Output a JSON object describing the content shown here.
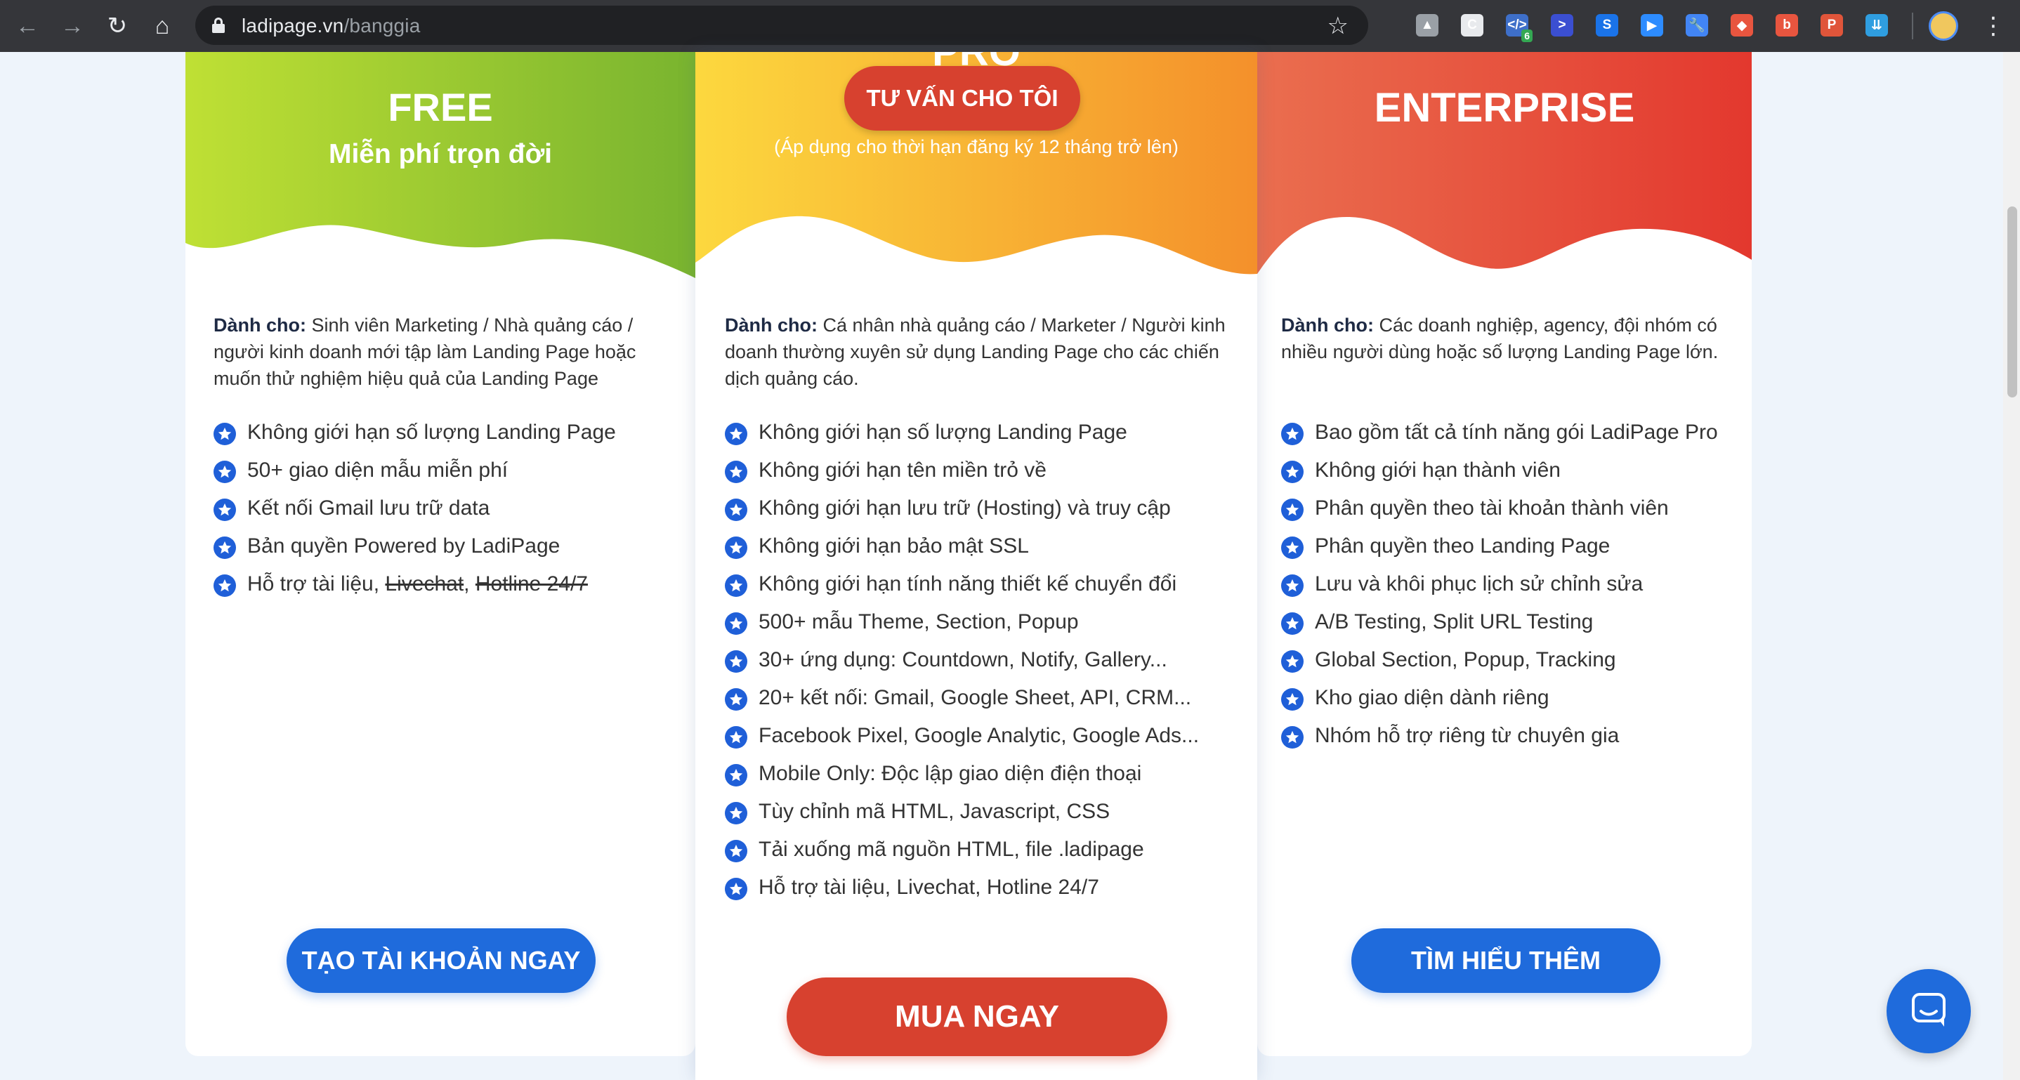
{
  "browser": {
    "url_domain": "ladipage.vn",
    "url_path": "/banggia",
    "extension_icons": [
      {
        "name": "google-drive-icon",
        "color": "#9aa0a6",
        "glyph": "▲"
      },
      {
        "name": "ext-c-icon",
        "color": "#e8eaed",
        "glyph": "C"
      },
      {
        "name": "code-icon",
        "color": "#3e6fc9",
        "glyph": "</>"
      },
      {
        "name": "terminal-icon",
        "color": "#3b4fd1",
        "glyph": ">"
      },
      {
        "name": "s-extension-icon",
        "color": "#1a73e8",
        "glyph": "S"
      },
      {
        "name": "zoom-icon",
        "color": "#2d8cff",
        "glyph": "▶"
      },
      {
        "name": "wrench-icon",
        "color": "#4285f4",
        "glyph": "🔧"
      },
      {
        "name": "shield-icon",
        "color": "#e8553f",
        "glyph": "◆"
      },
      {
        "name": "b-extension-icon",
        "color": "#e8553f",
        "glyph": "b"
      },
      {
        "name": "p-extension-icon",
        "color": "#e0553a",
        "glyph": "P"
      },
      {
        "name": "download-icon",
        "color": "#2f9ee0",
        "glyph": "⇊"
      }
    ],
    "extension_badge": "6"
  },
  "colors": {
    "free_gradient": [
      "#bfe034",
      "#79b42f"
    ],
    "pro_gradient": [
      "#fcd83e",
      "#f4902b"
    ],
    "enterprise_gradient": [
      "#ea6e4f",
      "#e3382e"
    ],
    "accent_blue": "#1f6bdc",
    "accent_red": "#d7412f"
  },
  "plans": {
    "free": {
      "name": "FREE",
      "subtitle": "Miễn phí trọn đời",
      "for_label": "Dành cho:",
      "for_text": "Sinh viên Marketing / Nhà quảng cáo / người kinh doanh mới tập làm Landing Page hoặc muốn thử nghiệm hiệu quả của Landing Page",
      "features": [
        "Không giới hạn số lượng Landing Page",
        "50+ giao diện mẫu miễn phí",
        "Kết nối Gmail lưu trữ data",
        "Bản quyền Powered by LadiPage"
      ],
      "support_prefix": "Hỗ trợ tài liệu,",
      "support_livechat": "Livechat",
      "support_comma": ",",
      "support_hotline": "Hotline 24/7",
      "button": "TẠO TÀI KHOẢN NGAY"
    },
    "pro": {
      "name_cut": "PRO",
      "consult_button": "TƯ VẤN CHO TÔI",
      "note": "(Áp dụng cho thời hạn đăng ký 12 tháng trở lên)",
      "for_label": "Dành cho:",
      "for_text": "Cá nhân nhà quảng cáo / Marketer / Người kinh doanh thường xuyên sử dụng Landing Page cho các chiến dịch quảng cáo.",
      "features": [
        "Không giới hạn số lượng Landing Page",
        "Không giới hạn tên miền trỏ về",
        "Không giới hạn lưu trữ (Hosting) và truy cập",
        "Không giới hạn bảo mật SSL",
        "Không giới hạn tính năng thiết kế chuyển đổi",
        "500+ mẫu Theme, Section, Popup",
        "30+ ứng dụng: Countdown, Notify, Gallery...",
        "20+ kết nối: Gmail, Google Sheet, API, CRM...",
        "Facebook Pixel, Google Analytic, Google Ads...",
        "Mobile Only: Độc lập giao diện điện thoại",
        "Tùy chỉnh mã HTML, Javascript, CSS",
        "Tải xuống mã nguồn HTML, file .ladipage",
        "Hỗ trợ tài liệu, Livechat, Hotline 24/7"
      ],
      "button": "MUA NGAY"
    },
    "enterprise": {
      "name": "ENTERPRISE",
      "for_label": "Dành cho:",
      "for_text": "Các doanh nghiệp, agency, đội nhóm có nhiều người dùng hoặc số lượng Landing Page lớn.",
      "features": [
        "Bao gồm tất cả tính năng gói LadiPage Pro",
        "Không giới hạn thành viên",
        "Phân quyền theo tài khoản thành viên",
        "Phân quyền theo Landing Page",
        "Lưu và khôi phục lịch sử chỉnh sửa",
        "A/B Testing, Split URL Testing",
        "Global Section, Popup, Tracking",
        "Kho giao diện dành riêng",
        "Nhóm hỗ trợ riêng từ chuyên gia"
      ],
      "button": "TÌM HIỂU THÊM"
    }
  }
}
